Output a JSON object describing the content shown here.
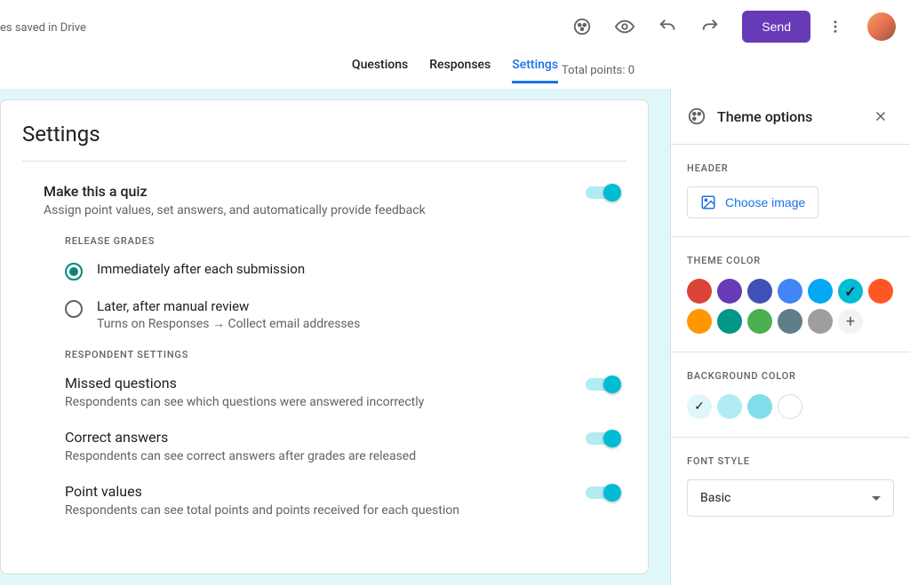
{
  "saveStatus": "es saved in Drive",
  "send": "Send",
  "tabs": {
    "questions": "Questions",
    "responses": "Responses",
    "settings": "Settings"
  },
  "totalPoints": "Total points: 0",
  "settings": {
    "title": "Settings",
    "quiz": {
      "title": "Make this a quiz",
      "desc": "Assign point values, set answers, and automatically provide feedback"
    },
    "releaseGradesLabel": "RELEASE GRADES",
    "release": {
      "immediate": "Immediately after each submission",
      "later": "Later, after manual review",
      "laterDesc": "Turns on Responses → Collect email addresses"
    },
    "respondentLabel": "RESPONDENT SETTINGS",
    "missed": {
      "title": "Missed questions",
      "desc": "Respondents can see which questions were answered incorrectly"
    },
    "correct": {
      "title": "Correct answers",
      "desc": "Respondents can see correct answers after grades are released"
    },
    "points": {
      "title": "Point values",
      "desc": "Respondents can see total points and points received for each question"
    }
  },
  "theme": {
    "title": "Theme options",
    "headerLabel": "HEADER",
    "chooseImage": "Choose image",
    "themeColorLabel": "THEME COLOR",
    "colors": [
      "#db4437",
      "#673ab7",
      "#3f51b5",
      "#4285f4",
      "#03a9f4",
      "#00bcd4",
      "#ff5722",
      "#ff9800",
      "#009688",
      "#4caf50",
      "#607d8b",
      "#9e9e9e"
    ],
    "selectedColorIndex": 5,
    "bgLabel": "BACKGROUND COLOR",
    "bgColors": [
      "#e0f7fa",
      "#b2ebf2",
      "#80deea"
    ],
    "selectedBgIndex": 0,
    "fontLabel": "FONT STYLE",
    "fontValue": "Basic"
  }
}
